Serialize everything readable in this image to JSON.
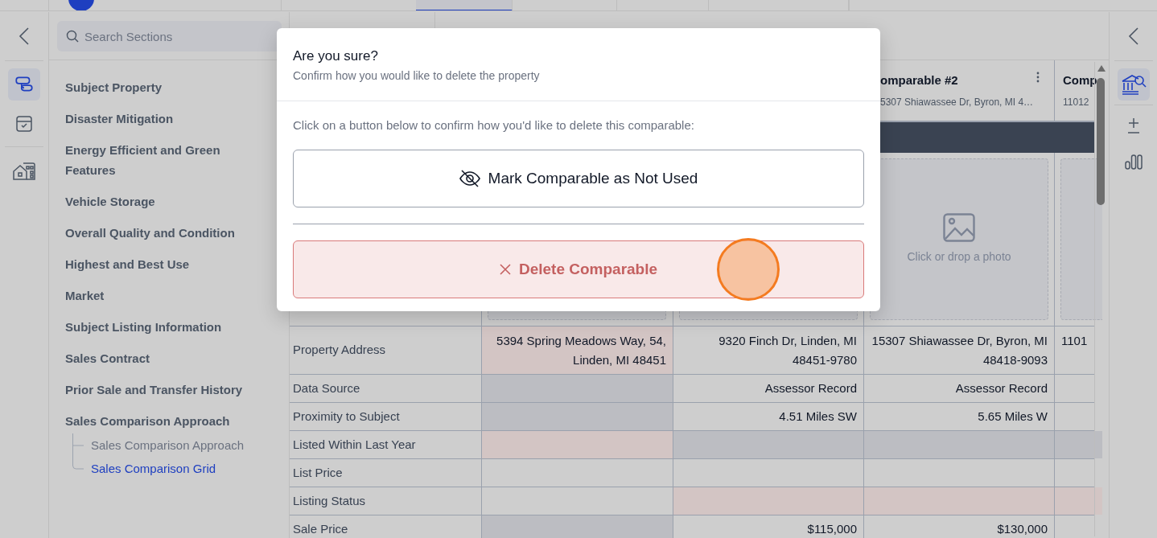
{
  "top_bar": {
    "tabs": [
      {
        "selected": false
      },
      {
        "selected": true
      },
      {
        "selected": false
      },
      {
        "selected": false
      },
      {
        "selected": false
      }
    ]
  },
  "left_rail": {
    "items": [
      {
        "selected": true
      },
      {
        "selected": false
      },
      {
        "selected": false
      }
    ]
  },
  "sidebar": {
    "search": {
      "placeholder": "Search Sections"
    },
    "items": [
      {
        "label": "Subject Property",
        "selected": false
      },
      {
        "label": "Disaster Mitigation",
        "selected": false
      },
      {
        "label": "Energy Efficient and Green Features",
        "selected": false
      },
      {
        "label": "Vehicle Storage",
        "selected": false
      },
      {
        "label": "Overall Quality and Condition",
        "selected": false
      },
      {
        "label": "Highest and Best Use",
        "selected": false
      },
      {
        "label": "Market",
        "selected": false
      },
      {
        "label": "Subject Listing Information",
        "selected": false
      },
      {
        "label": "Sales Contract",
        "selected": false
      },
      {
        "label": "Prior Sale and Transfer History",
        "selected": false
      },
      {
        "label": "Sales Comparison Approach",
        "selected": false,
        "children": [
          {
            "label": "Sales Comparison Approach",
            "selected": false
          },
          {
            "label": "Sales Comparison Grid",
            "selected": true
          }
        ]
      }
    ]
  },
  "grid": {
    "headers": [
      {
        "title": "omparable #2",
        "address": "5307 Shiawassee Dr, Byron, MI 4…"
      },
      {
        "title": "Comp",
        "address": "11012"
      }
    ],
    "photo_prompt": "Click or drop a photo",
    "rows": [
      {
        "label": "Property Address",
        "cells": [
          {
            "kind": "flagged",
            "text": "5394 Spring Meadows Way, 54, Linden, MI 48451"
          },
          {
            "kind": "plain",
            "text": "9320 Finch Dr, Linden, MI 48451-9780"
          },
          {
            "kind": "plain",
            "text": "15307 Shiawassee Dr, Byron, MI 48418-9093"
          },
          {
            "kind": "plain",
            "text": "1101"
          }
        ]
      },
      {
        "label": "Data Source",
        "cells": [
          {
            "kind": "disabled"
          },
          {
            "kind": "plain",
            "text": "Assessor Record"
          },
          {
            "kind": "plain",
            "text": "Assessor Record"
          },
          {
            "kind": "plain"
          }
        ]
      },
      {
        "label": "Proximity to Subject",
        "cells": [
          {
            "kind": "disabled"
          },
          {
            "kind": "plain",
            "text": "4.51 Miles SW"
          },
          {
            "kind": "plain",
            "text": "5.65 Miles W"
          },
          {
            "kind": "plain"
          }
        ]
      },
      {
        "label": "Listed Within Last Year",
        "cells": [
          {
            "kind": "flagged"
          },
          {
            "kind": "disabled"
          },
          {
            "kind": "disabled"
          },
          {
            "kind": "disabled"
          }
        ]
      },
      {
        "label": "List Price",
        "cells": [
          {
            "kind": "plain"
          },
          {
            "kind": "plain"
          },
          {
            "kind": "plain"
          },
          {
            "kind": "plain"
          }
        ]
      },
      {
        "label": "Listing Status",
        "cells": [
          {
            "kind": "plain"
          },
          {
            "kind": "flagged"
          },
          {
            "kind": "flagged"
          },
          {
            "kind": "flagged"
          }
        ]
      },
      {
        "label": "Sale Price",
        "cells": [
          {
            "kind": "disabled"
          },
          {
            "kind": "plain",
            "text": "$115,000"
          },
          {
            "kind": "plain",
            "text": "$130,000"
          },
          {
            "kind": "plain"
          }
        ]
      }
    ]
  },
  "right_rail": {
    "items": [
      {
        "selected": true
      },
      {
        "selected": false
      },
      {
        "selected": false
      }
    ]
  },
  "dialog": {
    "title": "Are you sure?",
    "subtitle": "Confirm how you would like to delete the property",
    "prompt": "Click on a button below to confirm how you'd like to delete this comparable:",
    "actions": [
      {
        "kind": "neutral",
        "label": "Mark Comparable as Not Used"
      },
      {
        "kind": "danger",
        "label": "Delete Comparable"
      }
    ]
  }
}
